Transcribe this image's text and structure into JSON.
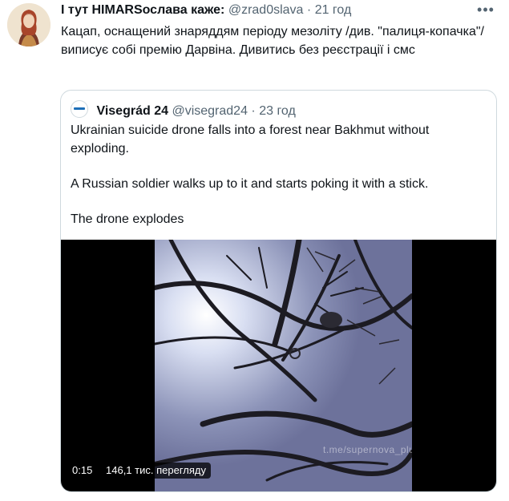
{
  "tweet": {
    "author_name": "І тут HIMARSослава каже:",
    "handle": "@zrad0slava",
    "separator": "·",
    "time": "21 год",
    "more_icon": "more-dots-icon",
    "text": "Кацап, оснащений знаряддям періоду мезоліту /див. \"палиця-копачка\"/  виписує собі премію Дарвіна. Дивитись без реєстрації і смс"
  },
  "quoted": {
    "author_name": "Visegrád 24",
    "handle": "@visegrad24",
    "separator": "·",
    "time": "23 год",
    "paragraphs": [
      "Ukrainian suicide drone falls into a forest near Bakhmut without exploding.",
      "A Russian soldier walks up to it and starts poking it with a stick.",
      "The drone explodes"
    ],
    "video": {
      "duration": "0:15",
      "views": "146,1 тис. перегляду",
      "watermark": "t.me/supernova_plus"
    }
  },
  "colors": {
    "text": "#0f1419",
    "secondary": "#536471",
    "border": "#cfd9de"
  }
}
